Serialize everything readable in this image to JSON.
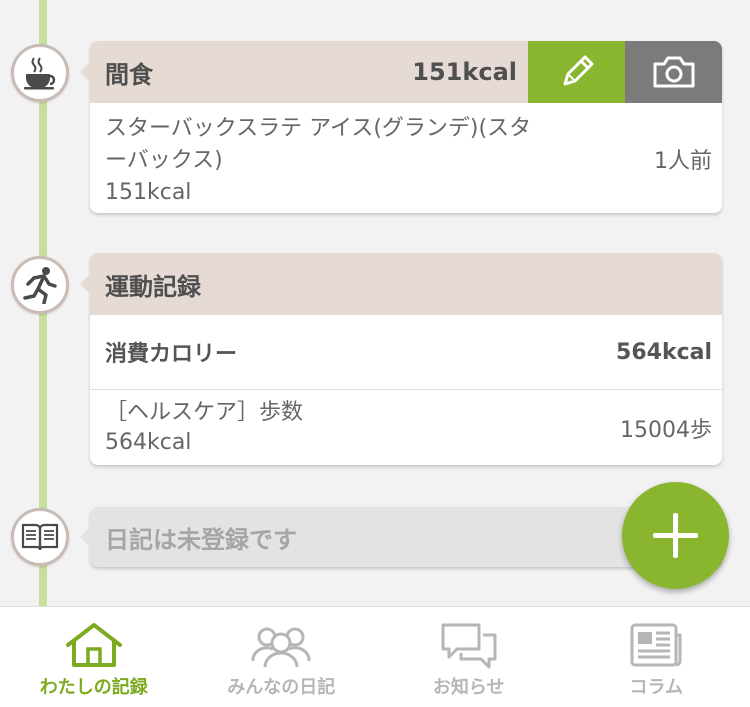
{
  "timeline_color": "#c6df9b",
  "accent_color": "#8ab62f",
  "meal": {
    "title": "間食",
    "kcal": "151kcal",
    "icon": "coffee-cup-icon",
    "edit_icon": "pencil-icon",
    "camera_icon": "camera-icon",
    "item": {
      "name": "スターバックスラテ アイス(グランデ)(スターバックス)",
      "kcal": "151kcal",
      "serving": "1人前"
    }
  },
  "exercise": {
    "title": "運動記録",
    "icon": "running-person-icon",
    "consumed_label": "消費カロリー",
    "consumed_value": "564kcal",
    "item": {
      "name": "［ヘルスケア］歩数",
      "kcal": "564kcal",
      "steps": "15004歩"
    }
  },
  "diary": {
    "icon": "open-book-icon",
    "placeholder": "日記は未登録です"
  },
  "fab": {
    "icon": "plus-icon"
  },
  "tabs": [
    {
      "label": "わたしの記録",
      "icon": "home-icon",
      "active": true
    },
    {
      "label": "みんなの日記",
      "icon": "people-icon",
      "active": false
    },
    {
      "label": "お知らせ",
      "icon": "speech-bubble-icon",
      "active": false
    },
    {
      "label": "コラム",
      "icon": "newspaper-icon",
      "active": false
    }
  ]
}
